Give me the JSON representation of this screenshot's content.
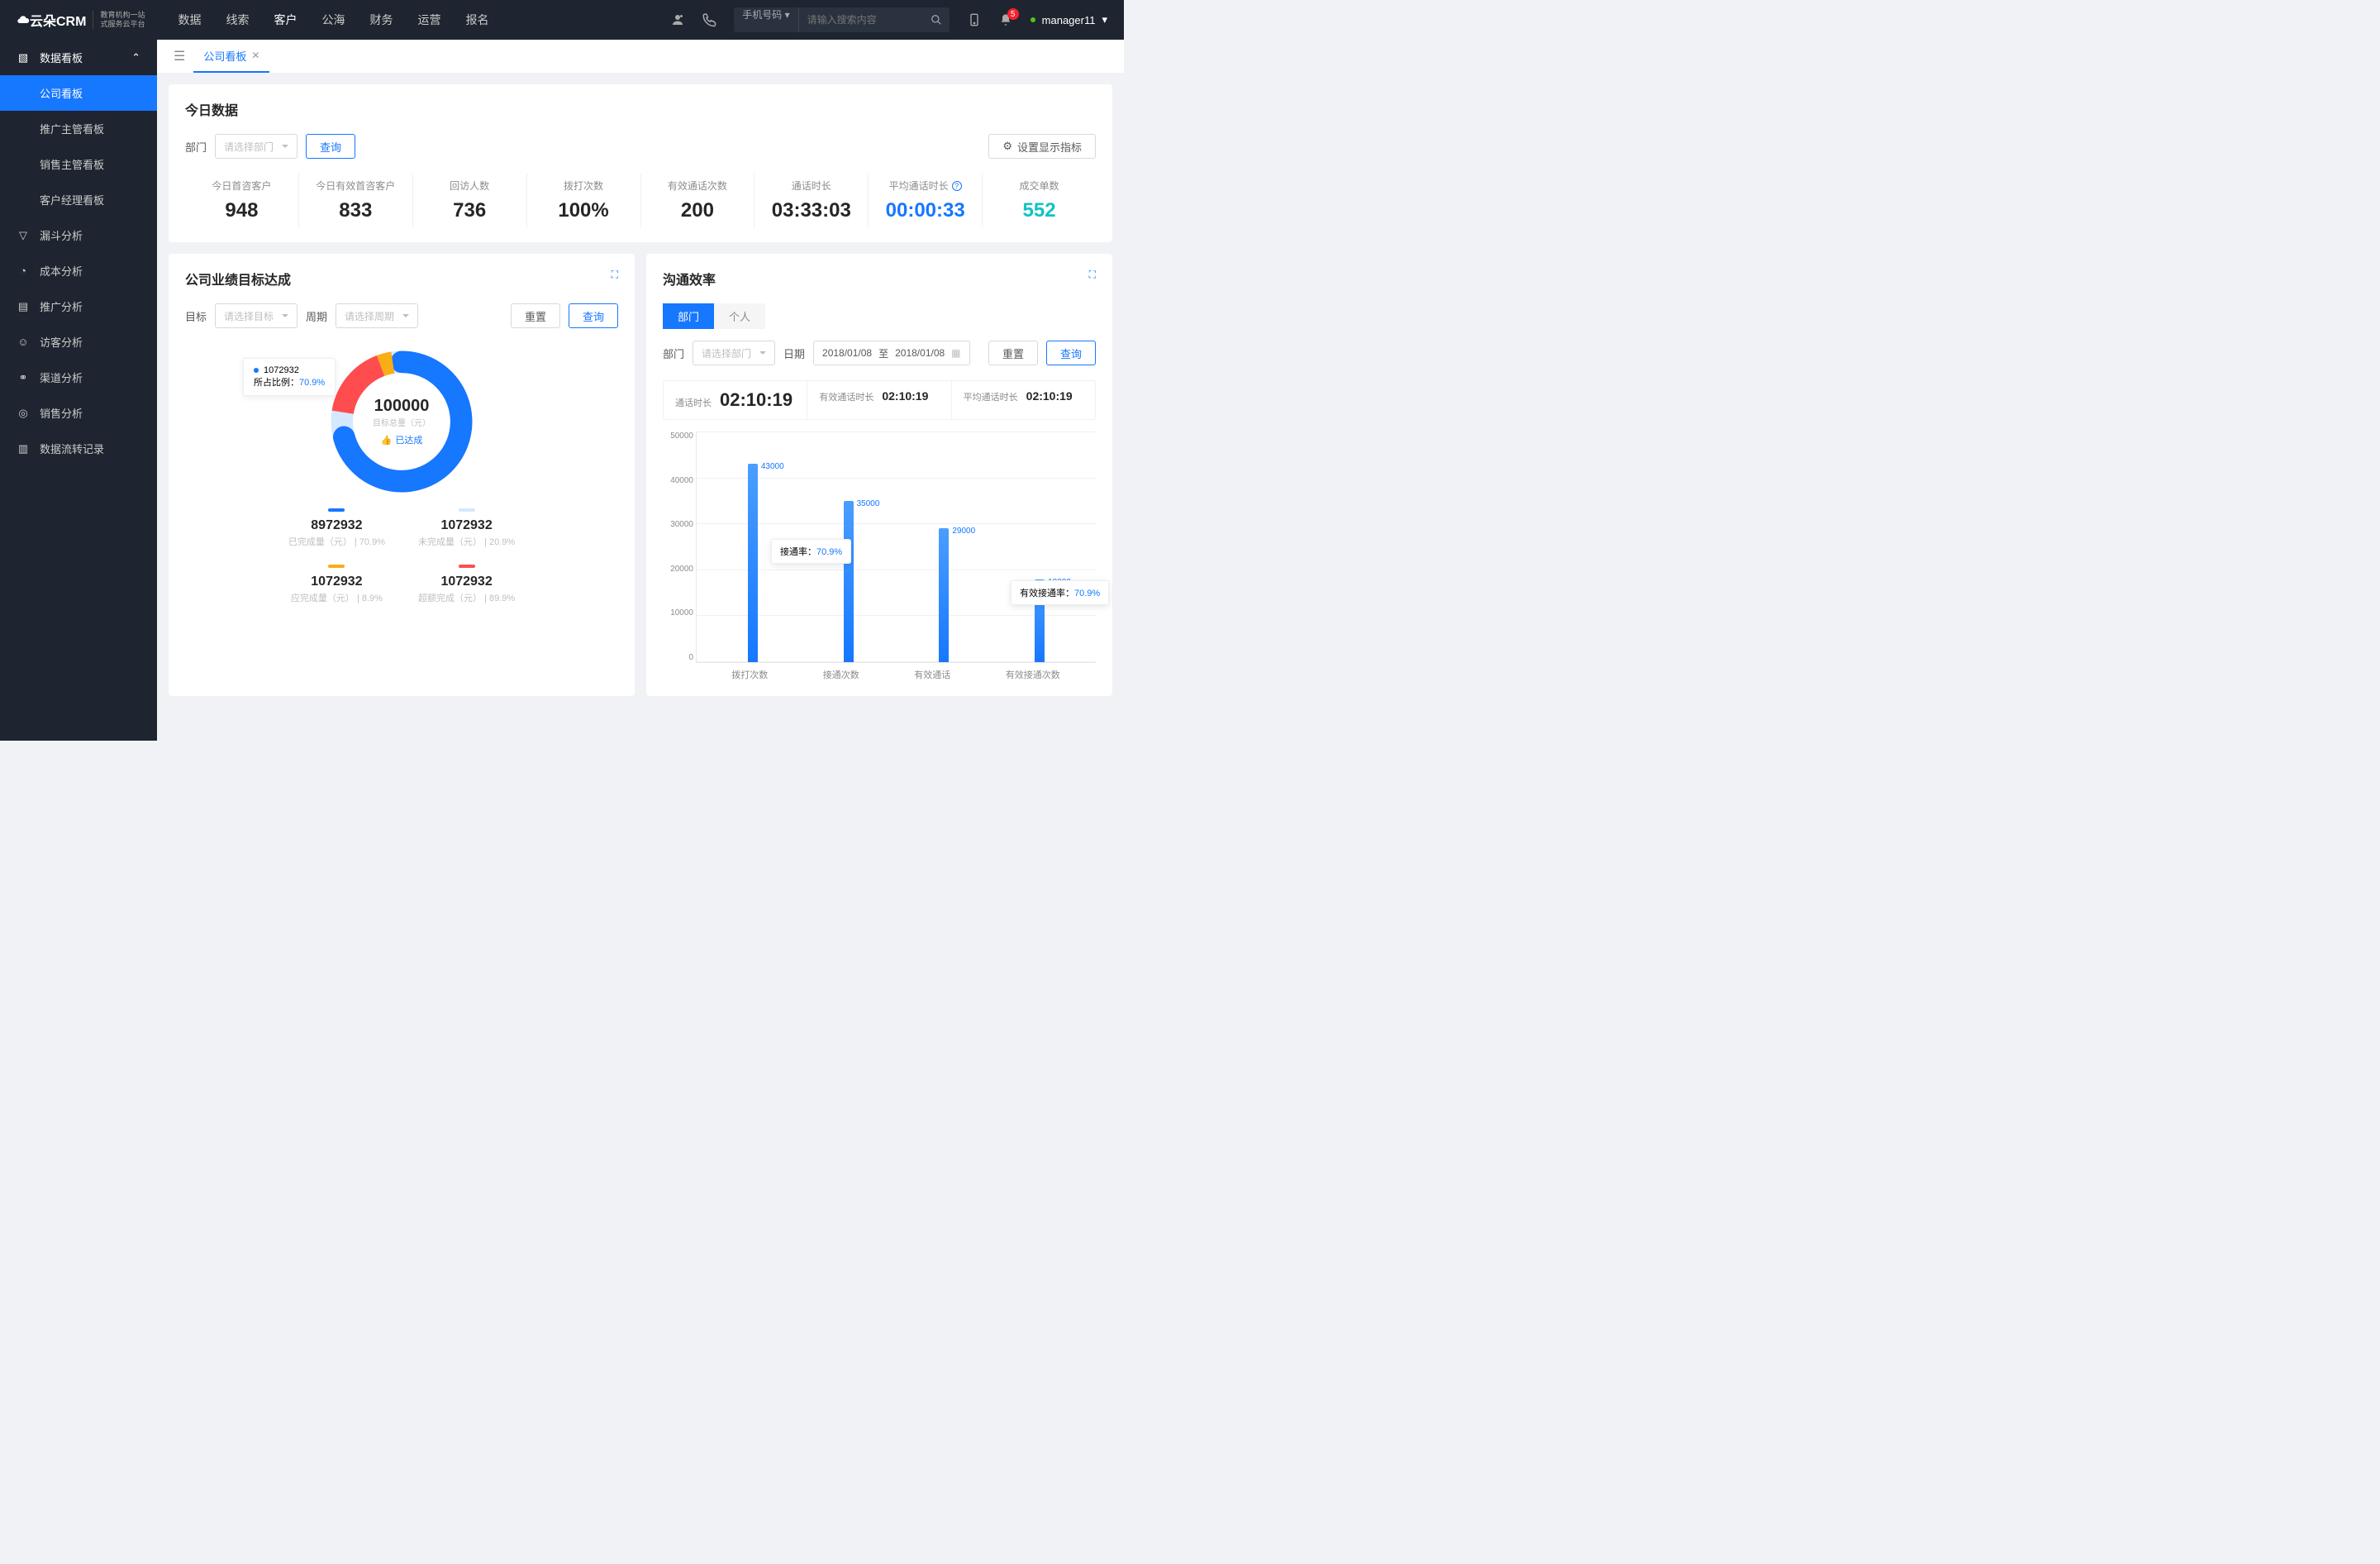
{
  "header": {
    "logo": "云朵CRM",
    "logo_sub1": "教育机构一站",
    "logo_sub2": "式服务云平台",
    "nav": [
      "数据",
      "线索",
      "客户",
      "公海",
      "财务",
      "运营",
      "报名"
    ],
    "nav_active": 2,
    "search_type": "手机号码",
    "search_placeholder": "请输入搜索内容",
    "notif_count": "5",
    "user": "manager11"
  },
  "sidebar": {
    "group": "数据看板",
    "group_items": [
      "公司看板",
      "推广主管看板",
      "销售主管看板",
      "客户经理看板"
    ],
    "items": [
      "漏斗分析",
      "成本分析",
      "推广分析",
      "访客分析",
      "渠道分析",
      "销售分析",
      "数据流转记录"
    ]
  },
  "tab": {
    "label": "公司看板"
  },
  "today": {
    "title": "今日数据",
    "dept_label": "部门",
    "dept_placeholder": "请选择部门",
    "query": "查询",
    "config": "设置显示指标",
    "metrics": [
      {
        "label": "今日首咨客户",
        "value": "948",
        "cls": ""
      },
      {
        "label": "今日有效首咨客户",
        "value": "833",
        "cls": ""
      },
      {
        "label": "回访人数",
        "value": "736",
        "cls": ""
      },
      {
        "label": "拨打次数",
        "value": "100%",
        "cls": ""
      },
      {
        "label": "有效通话次数",
        "value": "200",
        "cls": ""
      },
      {
        "label": "通话时长",
        "value": "03:33:03",
        "cls": ""
      },
      {
        "label": "平均通话时长",
        "value": "00:00:33",
        "cls": "blue",
        "info": true
      },
      {
        "label": "成交单数",
        "value": "552",
        "cls": "cyan"
      }
    ]
  },
  "target": {
    "title": "公司业绩目标达成",
    "goal_label": "目标",
    "goal_placeholder": "请选择目标",
    "period_label": "周期",
    "period_placeholder": "请选择周期",
    "reset": "重置",
    "query": "查询",
    "donut_value": "100000",
    "donut_sub": "目标总量（元）",
    "donut_badge": "已达成",
    "tip_value": "1072932",
    "tip_ratio_label": "所占比例：",
    "tip_ratio": "70.9%",
    "legends": [
      {
        "color": "#1677ff",
        "value": "8972932",
        "label": "已完成量（元）",
        "pct": "70.9%"
      },
      {
        "color": "#d6e8ff",
        "value": "1072932",
        "label": "未完成量（元）",
        "pct": "20.9%"
      },
      {
        "color": "#faad14",
        "value": "1072932",
        "label": "应完成量（元）",
        "pct": "8.9%"
      },
      {
        "color": "#ff4d4f",
        "value": "1072932",
        "label": "超额完成（元）",
        "pct": "89.9%"
      }
    ]
  },
  "comm": {
    "title": "沟通效率",
    "tabs": [
      "部门",
      "个人"
    ],
    "dept_label": "部门",
    "dept_placeholder": "请选择部门",
    "date_label": "日期",
    "date_from": "2018/01/08",
    "date_to": "2018/01/08",
    "date_sep": "至",
    "reset": "重置",
    "query": "查询",
    "kpis": [
      {
        "label": "通话时长",
        "value": "02:10:19",
        "big": true
      },
      {
        "label": "有效通话时长",
        "value": "02:10:19"
      },
      {
        "label": "平均通话时长",
        "value": "02:10:19"
      }
    ],
    "tooltip1": {
      "label": "接通率：",
      "value": "70.9%"
    },
    "tooltip2": {
      "label": "有效接通率：",
      "value": "70.9%"
    }
  },
  "chart_data": {
    "type": "bar",
    "categories": [
      "拨打次数",
      "接通次数",
      "有效通话",
      "有效接通次数"
    ],
    "values": [
      43000,
      35000,
      29000,
      18000
    ],
    "labels": [
      "43000",
      "35000",
      "29000",
      "18000"
    ],
    "ylim": [
      0,
      50000
    ],
    "yticks": [
      "50000",
      "40000",
      "30000",
      "20000",
      "10000",
      "0"
    ]
  }
}
